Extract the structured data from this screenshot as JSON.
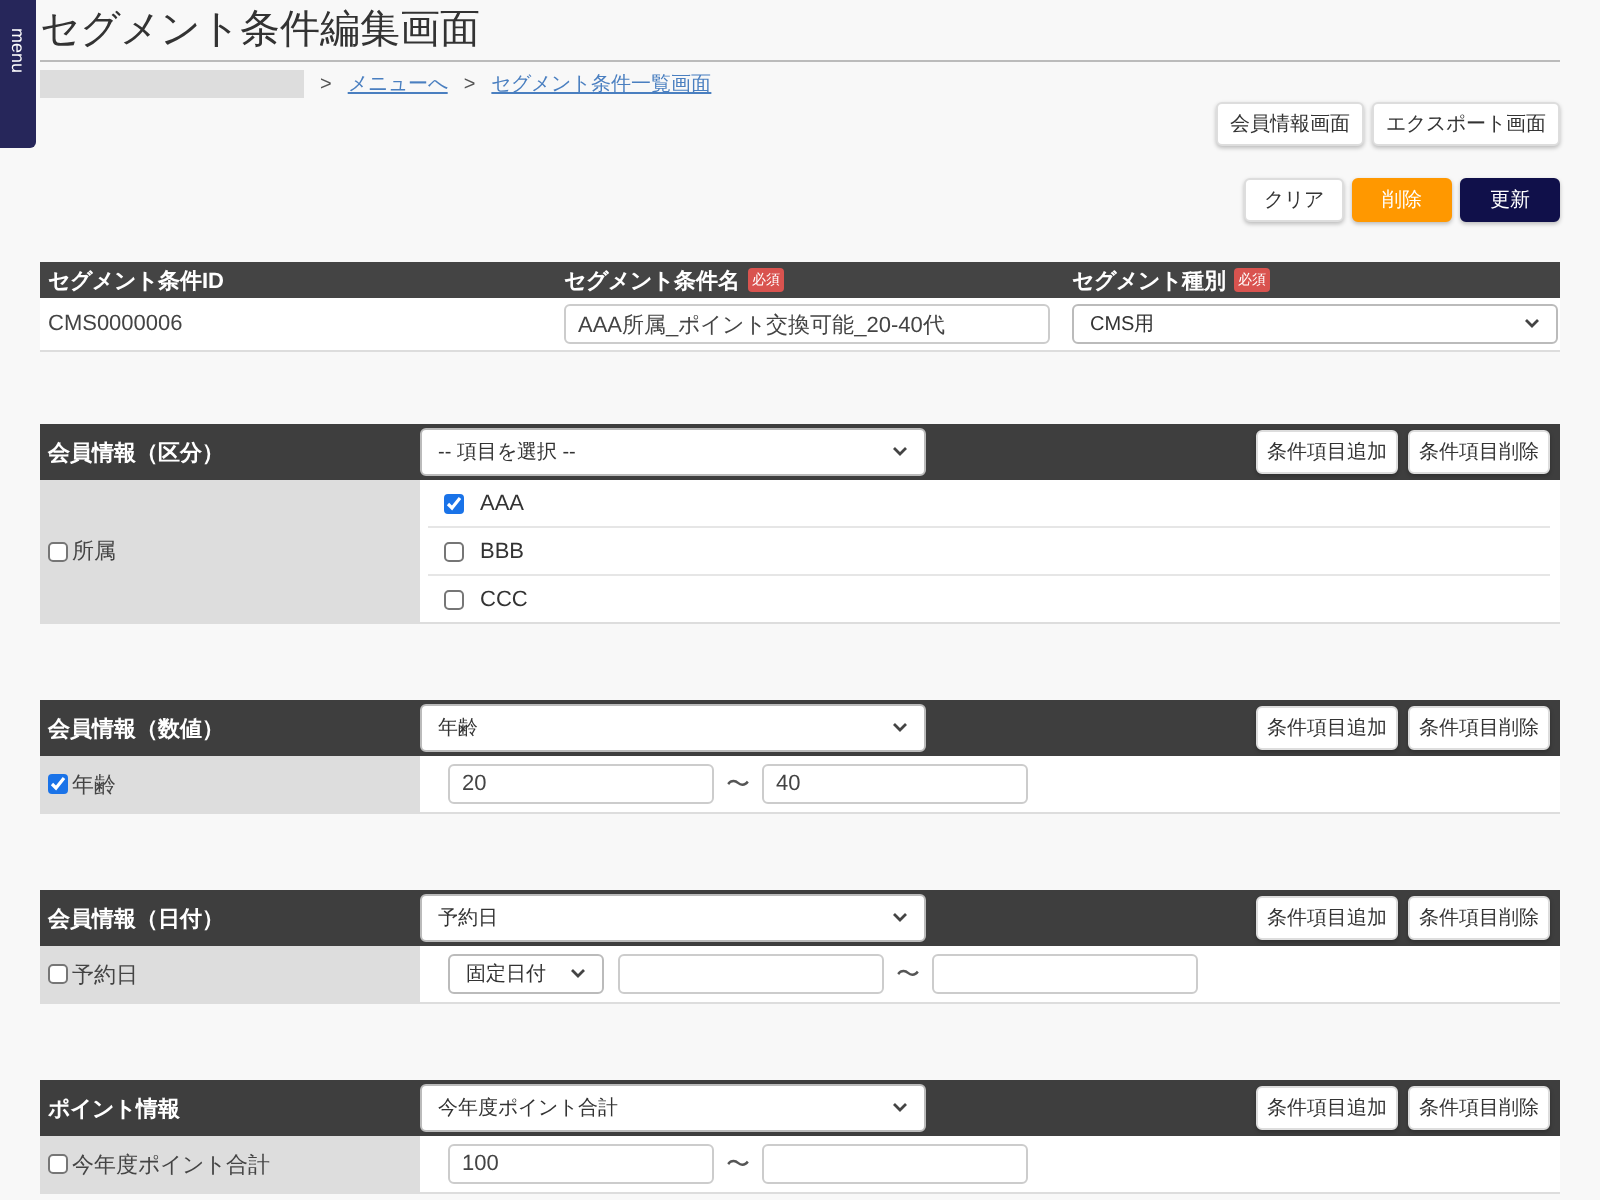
{
  "menu_tab": {
    "label": "menu"
  },
  "page_title": "セグメント条件編集画面",
  "breadcrumb": {
    "separators": [
      ">",
      ">"
    ],
    "links": [
      "メニューへ",
      "セグメント条件一覧画面"
    ]
  },
  "top_buttons": [
    "会員情報画面",
    "エクスポート画面"
  ],
  "action_buttons": [
    {
      "label": "クリア",
      "kind": "plain"
    },
    {
      "label": "削除",
      "kind": "warning"
    },
    {
      "label": "更新",
      "kind": "primary"
    }
  ],
  "segment_table": {
    "columns": [
      {
        "label": "セグメント条件ID",
        "required": false
      },
      {
        "label": "セグメント条件名",
        "required": true,
        "badge": "必須"
      },
      {
        "label": "セグメント種別",
        "required": true,
        "badge": "必須"
      }
    ],
    "id": "CMS0000006",
    "name_value": "AAA所属_ポイント交換可能_20-40代",
    "type_select": "CMS用"
  },
  "sections": [
    {
      "title": "会員情報（区分）",
      "select": "-- 項目を選択 --",
      "add_button": "条件項目追加",
      "remove_button": "条件項目削除",
      "field": "所属",
      "checked": false,
      "kind": "checklist",
      "options": [
        {
          "label": "AAA",
          "checked": true
        },
        {
          "label": "BBB",
          "checked": false
        },
        {
          "label": "CCC",
          "checked": false
        }
      ]
    },
    {
      "title": "会員情報（数値）",
      "select": "年齢",
      "add_button": "条件項目追加",
      "remove_button": "条件項目削除",
      "field": "年齢",
      "checked": true,
      "kind": "range",
      "from": "20",
      "to": "40",
      "tilde": "〜"
    },
    {
      "title": "会員情報（日付）",
      "select": "予約日",
      "add_button": "条件項目追加",
      "remove_button": "条件項目削除",
      "field": "予約日",
      "checked": false,
      "kind": "date_range",
      "mode": "固定日付",
      "tilde": "〜"
    },
    {
      "title": "ポイント情報",
      "select": "今年度ポイント合計",
      "add_button": "条件項目追加",
      "remove_button": "条件項目削除",
      "field": "今年度ポイント合計",
      "checked": false,
      "kind": "range",
      "from": "100",
      "tilde": "〜"
    }
  ]
}
